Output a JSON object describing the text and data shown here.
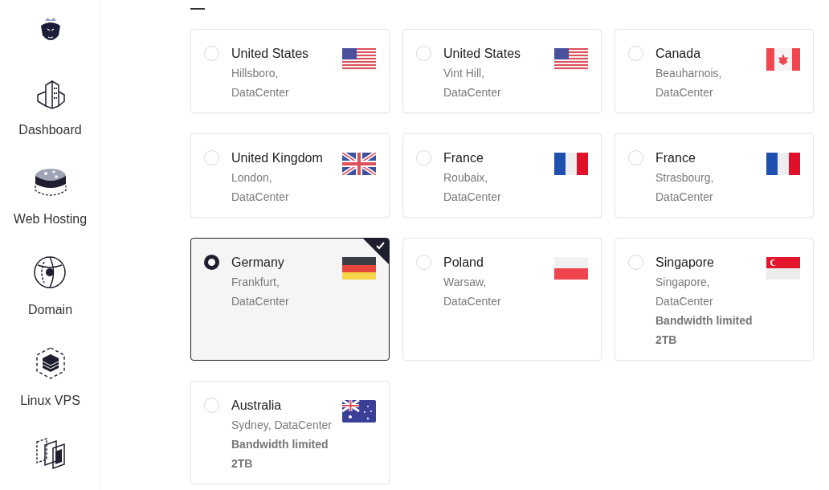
{
  "sidebar": {
    "items": [
      {
        "kind": "logo"
      },
      {
        "kind": "building",
        "label": "Dashboard"
      },
      {
        "kind": "server",
        "label": "Web Hosting"
      },
      {
        "kind": "globe",
        "label": "Domain"
      },
      {
        "kind": "cube",
        "label": "Linux VPS"
      },
      {
        "kind": "windows"
      }
    ]
  },
  "locations": [
    {
      "country": "United States",
      "location_lines": [
        "Hillsboro,",
        "DataCenter"
      ],
      "kind": "us",
      "selected": false
    },
    {
      "country": "United States",
      "location_lines": [
        "Vint Hill,",
        "DataCenter"
      ],
      "kind": "us",
      "selected": false
    },
    {
      "country": "Canada",
      "location_lines": [
        "Beauharnois,",
        "DataCenter"
      ],
      "kind": "ca",
      "selected": false
    },
    {
      "country": "United Kingdom",
      "location_lines": [
        "London,",
        "DataCenter"
      ],
      "kind": "gb",
      "selected": false
    },
    {
      "country": "France",
      "location_lines": [
        "Roubaix,",
        "DataCenter"
      ],
      "kind": "fr",
      "selected": false
    },
    {
      "country": "France",
      "location_lines": [
        "Strasbourg,",
        "DataCenter"
      ],
      "kind": "fr",
      "selected": false
    },
    {
      "country": "Germany",
      "location_lines": [
        "Frankfurt,",
        "DataCenter"
      ],
      "kind": "de",
      "selected": true
    },
    {
      "country": "Poland",
      "location_lines": [
        "Warsaw,",
        "DataCenter"
      ],
      "kind": "pl",
      "selected": false
    },
    {
      "country": "Singapore",
      "location_lines": [
        "Singapore,",
        "DataCenter"
      ],
      "note_lines": [
        "Bandwidth limited",
        "2TB"
      ],
      "kind": "sg",
      "selected": false
    },
    {
      "country": "Australia",
      "location_lines": [
        "Sydney, DataCenter"
      ],
      "note_lines": [
        "Bandwidth limited",
        "2TB"
      ],
      "kind": "au",
      "selected": false
    }
  ]
}
